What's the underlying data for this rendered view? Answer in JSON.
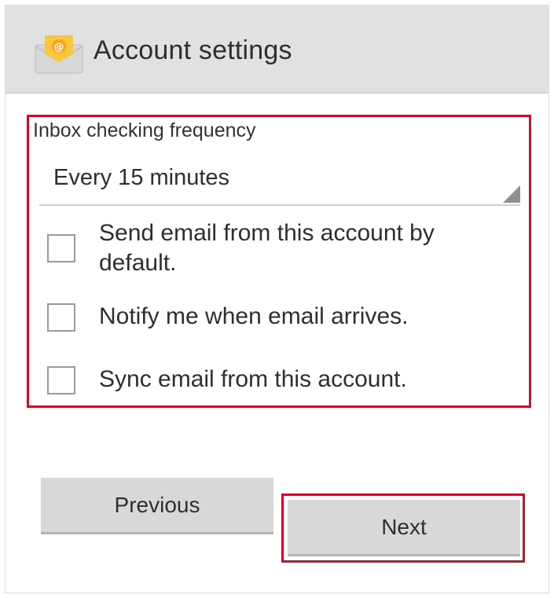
{
  "header": {
    "title": "Account settings",
    "icon": "email-icon"
  },
  "settings": {
    "frequency_label": "Inbox checking frequency",
    "frequency_value": "Every 15 minutes",
    "options": [
      {
        "label": "Send email from this account by default.",
        "checked": false
      },
      {
        "label": "Notify me when email arrives.",
        "checked": false
      },
      {
        "label": "Sync email from this account.",
        "checked": false
      }
    ]
  },
  "buttons": {
    "previous_label": "Previous",
    "next_label": "Next"
  },
  "colors": {
    "highlight": "#c8102e",
    "header_bg": "#e1e1e1",
    "button_bg": "#d8d8d8"
  }
}
